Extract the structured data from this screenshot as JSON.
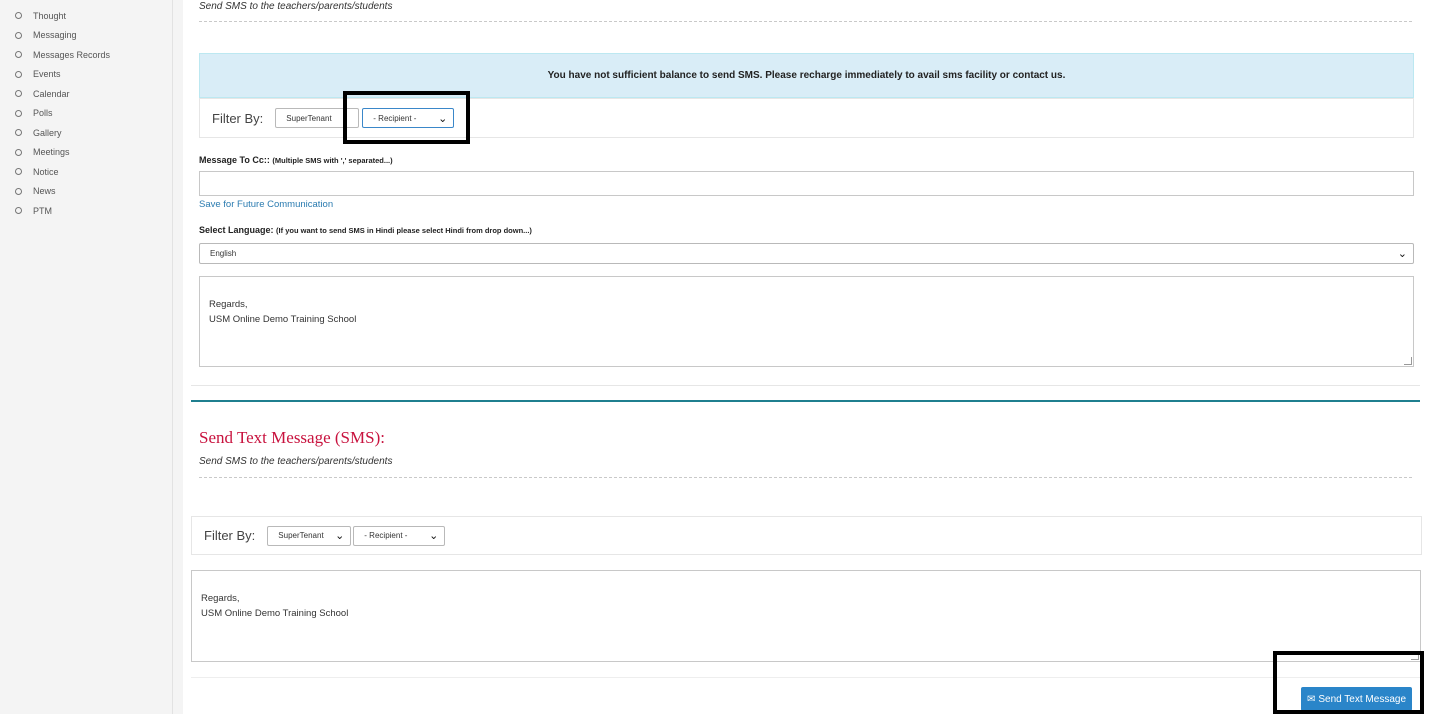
{
  "sidebar": {
    "items": [
      {
        "label": "Thought"
      },
      {
        "label": "Messaging"
      },
      {
        "label": "Messages Records"
      },
      {
        "label": "Events"
      },
      {
        "label": "Calendar"
      },
      {
        "label": "Polls"
      },
      {
        "label": "Gallery"
      },
      {
        "label": "Meetings"
      },
      {
        "label": "Notice"
      },
      {
        "label": "News"
      },
      {
        "label": "PTM"
      }
    ]
  },
  "top_section": {
    "subtitle": "Send SMS to the teachers/parents/students",
    "alert": "You have not sufficient balance to send SMS. Please recharge immediately to avail sms facility or contact us.",
    "filter": {
      "label": "Filter By:",
      "tenant_value": "SuperTenant",
      "recipient_value": "- Recipient -"
    },
    "cc": {
      "label": "Message To Cc::",
      "hint": "(Multiple SMS with ',' separated...)",
      "value": ""
    },
    "save_link": "Save for Future Communication",
    "language": {
      "label": "Select Language:",
      "hint": "(If you want to send SMS in Hindi please select Hindi from drop down...)",
      "value": "English"
    },
    "message": {
      "line1": "Regards,",
      "line2": "USM Online Demo Training School"
    }
  },
  "sms_section": {
    "title": "Send Text Message (SMS):",
    "subtitle": "Send SMS to the teachers/parents/students",
    "filter": {
      "label": "Filter By:",
      "tenant_value": "SuperTenant",
      "recipient_value": "- Recipient -"
    },
    "message": {
      "line1": "Regards,",
      "line2": "USM Online Demo Training School"
    },
    "send_button": "Send Text Message"
  },
  "colors": {
    "accent_title": "#c8123e",
    "primary_button": "#2a85c9",
    "link": "#2a7bb0",
    "alert_bg": "#d9edf7",
    "section_rule": "#1f7f8f"
  },
  "icons": {
    "sidebar_bullet": "circle-icon",
    "dropdown": "chevron-down-icon",
    "send": "envelope-icon"
  }
}
